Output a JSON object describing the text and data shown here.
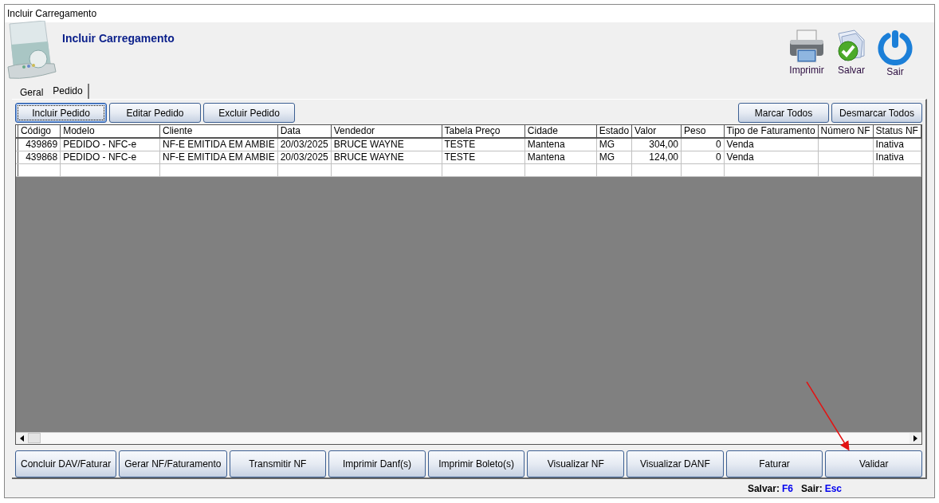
{
  "window": {
    "title": "Incluir Carregamento"
  },
  "header": {
    "title": "Incluir Carregamento"
  },
  "toolbar": [
    {
      "kind": "print",
      "label": "Imprimir"
    },
    {
      "kind": "save",
      "label": "Salvar"
    },
    {
      "kind": "exit",
      "label": "Sair"
    }
  ],
  "tabs": [
    {
      "label": "Geral",
      "selected": false
    },
    {
      "label": "Pedido",
      "selected": true
    }
  ],
  "order_buttons": [
    {
      "label": "Incluir Pedido",
      "focused": true
    },
    {
      "label": "Editar Pedido",
      "focused": false
    },
    {
      "label": "Excluir Pedido",
      "focused": false
    }
  ],
  "selection_buttons": [
    "Marcar Todos",
    "Desmarcar Todos"
  ],
  "table": {
    "columns": [
      "Código",
      "Modelo",
      "Cliente",
      "Data",
      "Vendedor",
      "Tabela Preço",
      "Cidade",
      "Estado",
      "Valor",
      "Peso",
      "Tipo de Faturamento",
      "Número NF",
      "Status NF"
    ],
    "rows": [
      [
        "439869",
        "PEDIDO - NFC-e",
        "NF-E EMITIDA EM AMBIE",
        "20/03/2025",
        "BRUCE WAYNE",
        "TESTE",
        "Mantena",
        "MG",
        "304,00",
        "0",
        "Venda",
        "",
        "Inativa"
      ],
      [
        "439868",
        "PEDIDO - NFC-e",
        "NF-E EMITIDA EM AMBIE",
        "20/03/2025",
        "BRUCE WAYNE",
        "TESTE",
        "Mantena",
        "MG",
        "124,00",
        "0",
        "Venda",
        "",
        "Inativa"
      ]
    ]
  },
  "action_buttons": [
    "Concluir DAV/Faturar",
    "Gerar NF/Faturamento",
    "Transmitir NF",
    "Imprimir Danf(s)",
    "Imprimir Boleto(s)",
    "Visualizar NF",
    "Visualizar DANF",
    "Faturar",
    "Validar"
  ],
  "status_bar": [
    {
      "label": "Salvar:",
      "key": "F6"
    },
    {
      "label": "Sair:",
      "key": "Esc"
    }
  ]
}
